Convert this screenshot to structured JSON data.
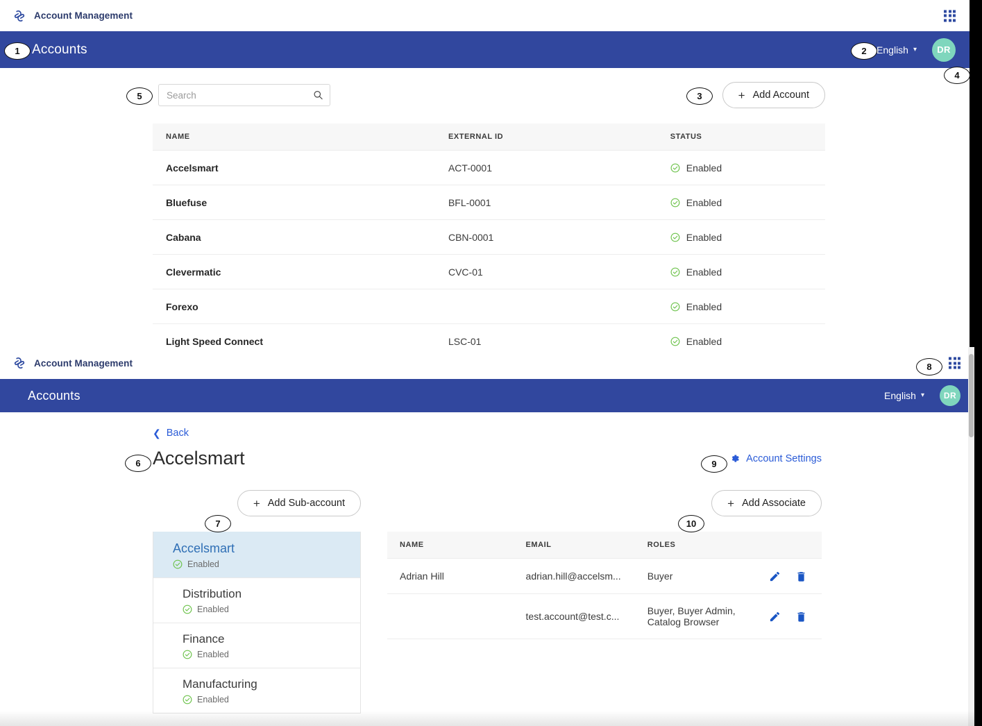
{
  "brand": {
    "title": "Account Management",
    "logo_icon": "paperclip-swirl-logo",
    "apps_grid_icon": "apps-grid-icon"
  },
  "colors": {
    "header_blue": "#31479E",
    "link_blue": "#2A5BD7",
    "avatar_teal": "#7FD6BD",
    "status_green": "#6CC24A",
    "selected_row": "#DBEAF4"
  },
  "panel_one": {
    "appbar": {
      "title": "Accounts",
      "language": "English",
      "language_chevron_icon": "chevron-down-icon",
      "avatar_initials": "DR"
    },
    "search": {
      "placeholder": "Search",
      "value": "",
      "icon": "search-icon"
    },
    "add_account": {
      "label": "Add Account",
      "plus_icon": "plus-icon"
    },
    "table": {
      "columns": [
        "NAME",
        "EXTERNAL ID",
        "STATUS"
      ],
      "rows": [
        {
          "name": "Accelsmart",
          "external_id": "ACT-0001",
          "status": "Enabled",
          "status_icon": "check-circle-icon"
        },
        {
          "name": "Bluefuse",
          "external_id": "BFL-0001",
          "status": "Enabled",
          "status_icon": "check-circle-icon"
        },
        {
          "name": "Cabana",
          "external_id": "CBN-0001",
          "status": "Enabled",
          "status_icon": "check-circle-icon"
        },
        {
          "name": "Clevermatic",
          "external_id": "CVC-01",
          "status": "Enabled",
          "status_icon": "check-circle-icon"
        },
        {
          "name": "Forexo",
          "external_id": "",
          "status": "Enabled",
          "status_icon": "check-circle-icon"
        },
        {
          "name": "Light Speed Connect",
          "external_id": "LSC-01",
          "status": "Enabled",
          "status_icon": "check-circle-icon"
        }
      ]
    }
  },
  "panel_two": {
    "appbar": {
      "title": "Accounts",
      "language": "English",
      "language_chevron_icon": "chevron-down-icon",
      "avatar_initials": "DR"
    },
    "back": {
      "label": "Back",
      "icon": "chevron-left-icon"
    },
    "detail_title": "Accelsmart",
    "account_settings": {
      "label": "Account Settings",
      "icon": "gear-icon"
    },
    "add_sub_account": {
      "label": "Add Sub-account",
      "plus_icon": "plus-icon"
    },
    "add_associate": {
      "label": "Add Associate",
      "plus_icon": "plus-icon"
    },
    "sub_accounts": [
      {
        "name": "Accelsmart",
        "status": "Enabled",
        "status_icon": "check-circle-icon",
        "selected": true,
        "level": 0
      },
      {
        "name": "Distribution",
        "status": "Enabled",
        "status_icon": "check-circle-icon",
        "selected": false,
        "level": 1
      },
      {
        "name": "Finance",
        "status": "Enabled",
        "status_icon": "check-circle-icon",
        "selected": false,
        "level": 1
      },
      {
        "name": "Manufacturing",
        "status": "Enabled",
        "status_icon": "check-circle-icon",
        "selected": false,
        "level": 1
      }
    ],
    "associates": {
      "columns": [
        "NAME",
        "EMAIL",
        "ROLES"
      ],
      "rows": [
        {
          "name": "Adrian Hill",
          "email": "adrian.hill@accelsm...",
          "roles": "Buyer",
          "edit_icon": "pencil-icon",
          "delete_icon": "trash-icon"
        },
        {
          "name": "",
          "email": "test.account@test.c...",
          "roles": "Buyer, Buyer Admin, Catalog Browser",
          "edit_icon": "pencil-icon",
          "delete_icon": "trash-icon"
        }
      ]
    }
  },
  "markers": [
    {
      "number": "1",
      "target": "accounts-appbar-title"
    },
    {
      "number": "2",
      "target": "language-selector"
    },
    {
      "number": "3",
      "target": "add-account-button"
    },
    {
      "number": "4",
      "target": "user-avatar"
    },
    {
      "number": "5",
      "target": "search-input"
    },
    {
      "number": "6",
      "target": "account-detail-title"
    },
    {
      "number": "7",
      "target": "add-sub-account-button"
    },
    {
      "number": "8",
      "target": "apps-grid-icon"
    },
    {
      "number": "9",
      "target": "account-settings-link"
    },
    {
      "number": "10",
      "target": "add-associate-button"
    }
  ]
}
